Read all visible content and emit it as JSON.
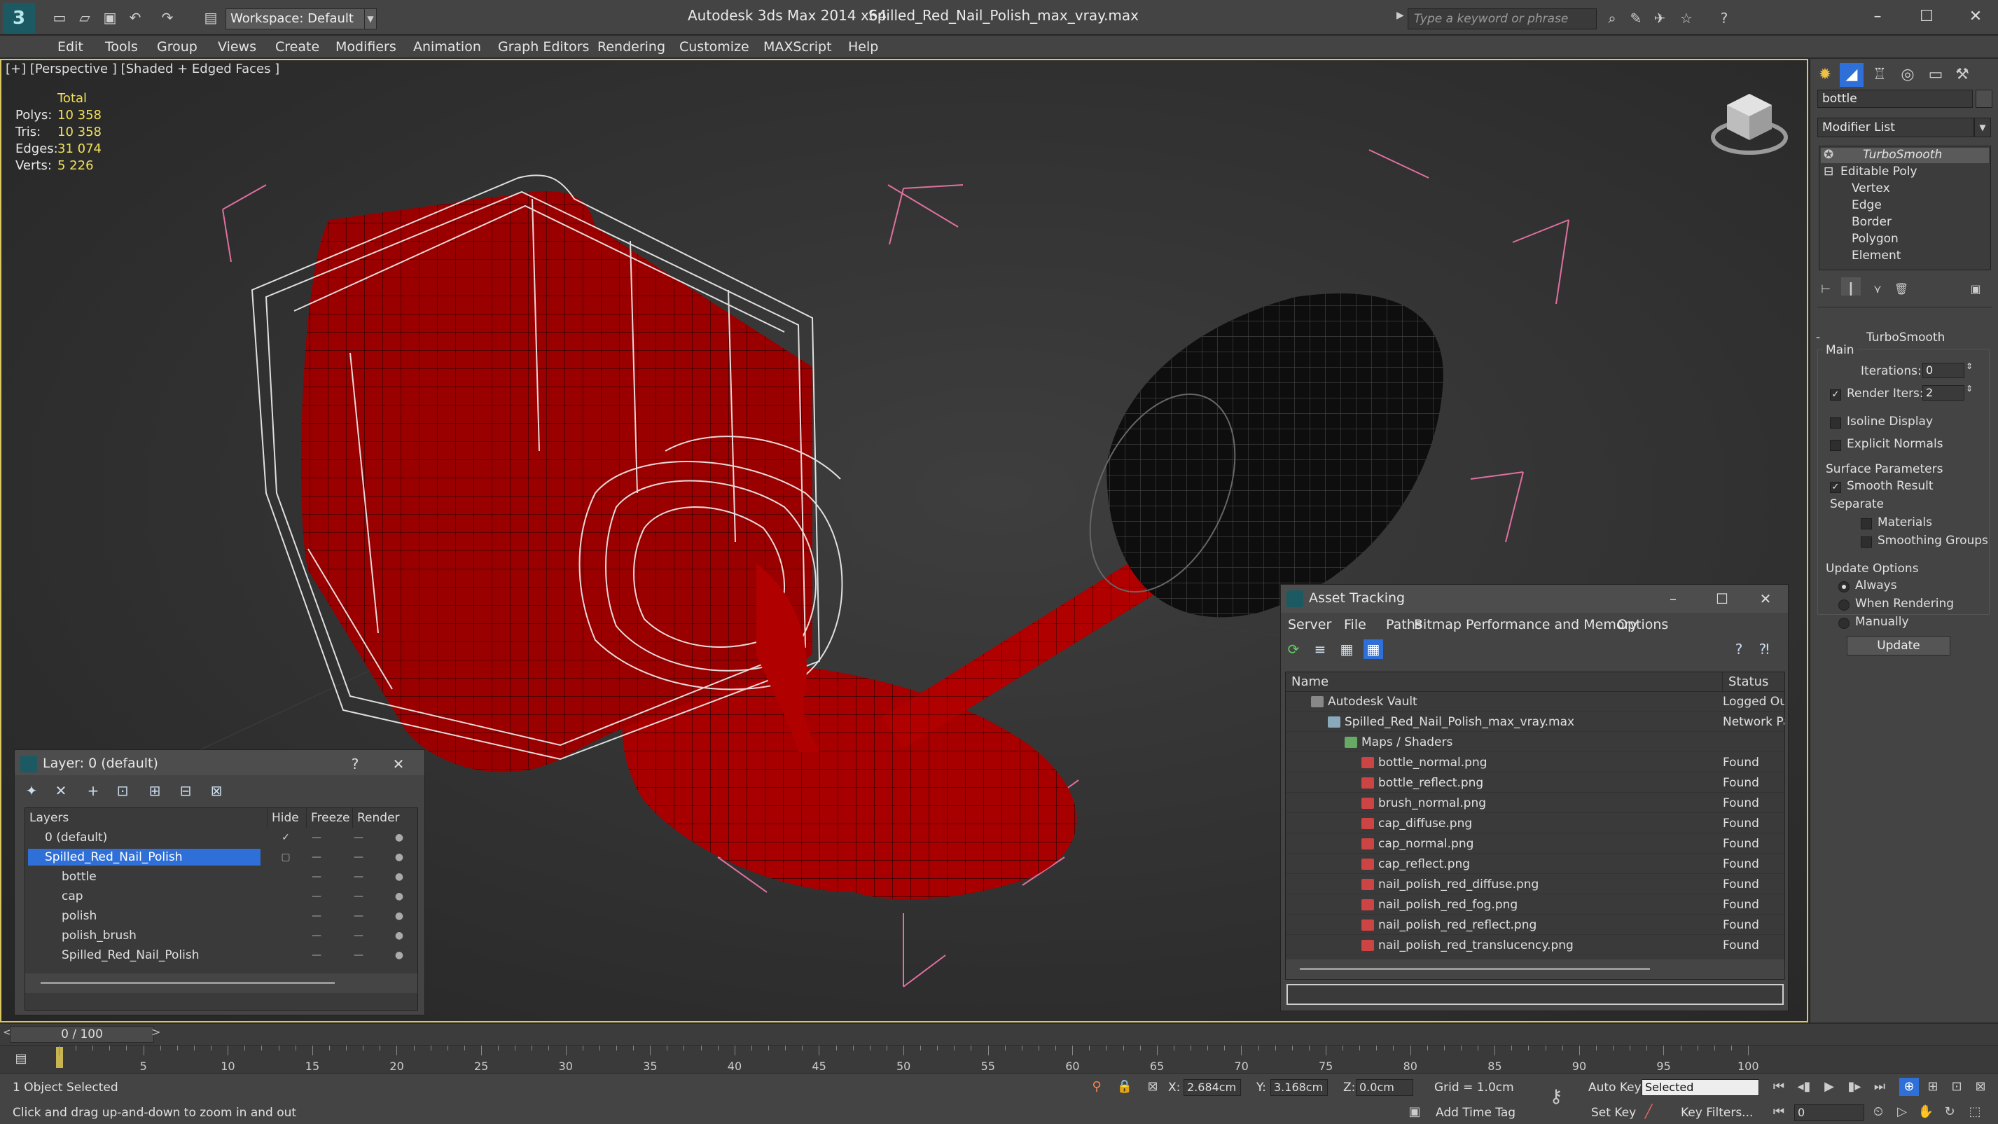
{
  "app": {
    "logo": "3",
    "title": "Autodesk 3ds Max  2014 x64",
    "file": "Spilled_Red_Nail_Polish_max_vray.max",
    "workspace": "Workspace: Default",
    "search_placeholder": "Type a keyword or phrase"
  },
  "menu": [
    "Edit",
    "Tools",
    "Group",
    "Views",
    "Create",
    "Modifiers",
    "Animation",
    "Graph Editors",
    "Rendering",
    "Customize",
    "MAXScript",
    "Help"
  ],
  "viewport": {
    "label": "[+] [Perspective ] [Shaded + Edged Faces ]",
    "stats": {
      "header": "Total",
      "rows": [
        {
          "label": "Polys:",
          "value": "10 358"
        },
        {
          "label": "Tris:",
          "value": "10 358"
        },
        {
          "label": "Edges:",
          "value": "31 074"
        },
        {
          "label": "Verts:",
          "value": "5 226"
        }
      ]
    }
  },
  "command_panel": {
    "object_name": "bottle",
    "modifier_list": "Modifier List",
    "stack": [
      "TurboSmooth",
      "Editable Poly",
      "Vertex",
      "Edge",
      "Border",
      "Polygon",
      "Element"
    ],
    "rollout_title": "TurboSmooth",
    "main_label": "Main",
    "iterations_label": "Iterations:",
    "iterations_value": "0",
    "render_iters_label": "Render Iters:",
    "render_iters_value": "2",
    "isoline": "Isoline Display",
    "explicit_normals": "Explicit Normals",
    "surface_params": "Surface Parameters",
    "smooth_result": "Smooth Result",
    "separate": "Separate",
    "materials": "Materials",
    "smoothing_groups": "Smoothing Groups",
    "update_options": "Update Options",
    "always": "Always",
    "when_rendering": "When Rendering",
    "manually": "Manually",
    "update_button": "Update"
  },
  "layer_dialog": {
    "title": "Layer: 0 (default)",
    "help": "?",
    "columns": [
      "Layers",
      "Hide",
      "Freeze",
      "Render"
    ],
    "rows": [
      {
        "name": "0 (default)",
        "indent": 0,
        "selected": false
      },
      {
        "name": "Spilled_Red_Nail_Polish",
        "indent": 0,
        "selected": true
      },
      {
        "name": "bottle",
        "indent": 1,
        "selected": false
      },
      {
        "name": "cap",
        "indent": 1,
        "selected": false
      },
      {
        "name": "polish",
        "indent": 1,
        "selected": false
      },
      {
        "name": "polish_brush",
        "indent": 1,
        "selected": false
      },
      {
        "name": "Spilled_Red_Nail_Polish",
        "indent": 1,
        "selected": false
      }
    ]
  },
  "asset_tracking": {
    "title": "Asset Tracking",
    "menu": [
      "Server",
      "File",
      "Paths",
      "Bitmap Performance and Memory",
      "Options"
    ],
    "columns": [
      "Name",
      "Status"
    ],
    "rows": [
      {
        "name": "Autodesk Vault",
        "status": "Logged Out",
        "level": 0
      },
      {
        "name": "Spilled_Red_Nail_Polish_max_vray.max",
        "status": "Network Path",
        "level": 1
      },
      {
        "name": "Maps / Shaders",
        "status": "",
        "level": 2
      },
      {
        "name": "bottle_normal.png",
        "status": "Found",
        "level": 3
      },
      {
        "name": "bottle_reflect.png",
        "status": "Found",
        "level": 3
      },
      {
        "name": "brush_normal.png",
        "status": "Found",
        "level": 3
      },
      {
        "name": "cap_diffuse.png",
        "status": "Found",
        "level": 3
      },
      {
        "name": "cap_normal.png",
        "status": "Found",
        "level": 3
      },
      {
        "name": "cap_reflect.png",
        "status": "Found",
        "level": 3
      },
      {
        "name": "nail_polish_red_diffuse.png",
        "status": "Found",
        "level": 3
      },
      {
        "name": "nail_polish_red_fog.png",
        "status": "Found",
        "level": 3
      },
      {
        "name": "nail_polish_red_reflect.png",
        "status": "Found",
        "level": 3
      },
      {
        "name": "nail_polish_red_translucency.png",
        "status": "Found",
        "level": 3
      }
    ]
  },
  "timeline": {
    "frame": "0 / 100",
    "ticks": [
      "5",
      "10",
      "15",
      "20",
      "25",
      "30",
      "35",
      "40",
      "45",
      "50",
      "55",
      "60",
      "65",
      "70",
      "75",
      "80",
      "85",
      "90",
      "95",
      "100"
    ]
  },
  "status": {
    "selection": "1 Object Selected",
    "hint": "Click and drag up-and-down to zoom in and out",
    "x_label": "X:",
    "x_value": "2.684cm",
    "y_label": "Y:",
    "y_value": "3.168cm",
    "z_label": "Z:",
    "z_value": "0.0cm",
    "grid": "Grid = 1.0cm",
    "add_time_tag": "Add Time Tag",
    "auto_key": "Auto Key",
    "set_key": "Set Key",
    "selected_dropdown": "Selected",
    "key_filters": "Key Filters...",
    "frame_field": "0"
  },
  "colors": {
    "accent_blue": "#2f6fd8",
    "viewport_border": "#d9c860",
    "polish_red": "#b50000",
    "stat_yellow": "#f0e15a"
  }
}
